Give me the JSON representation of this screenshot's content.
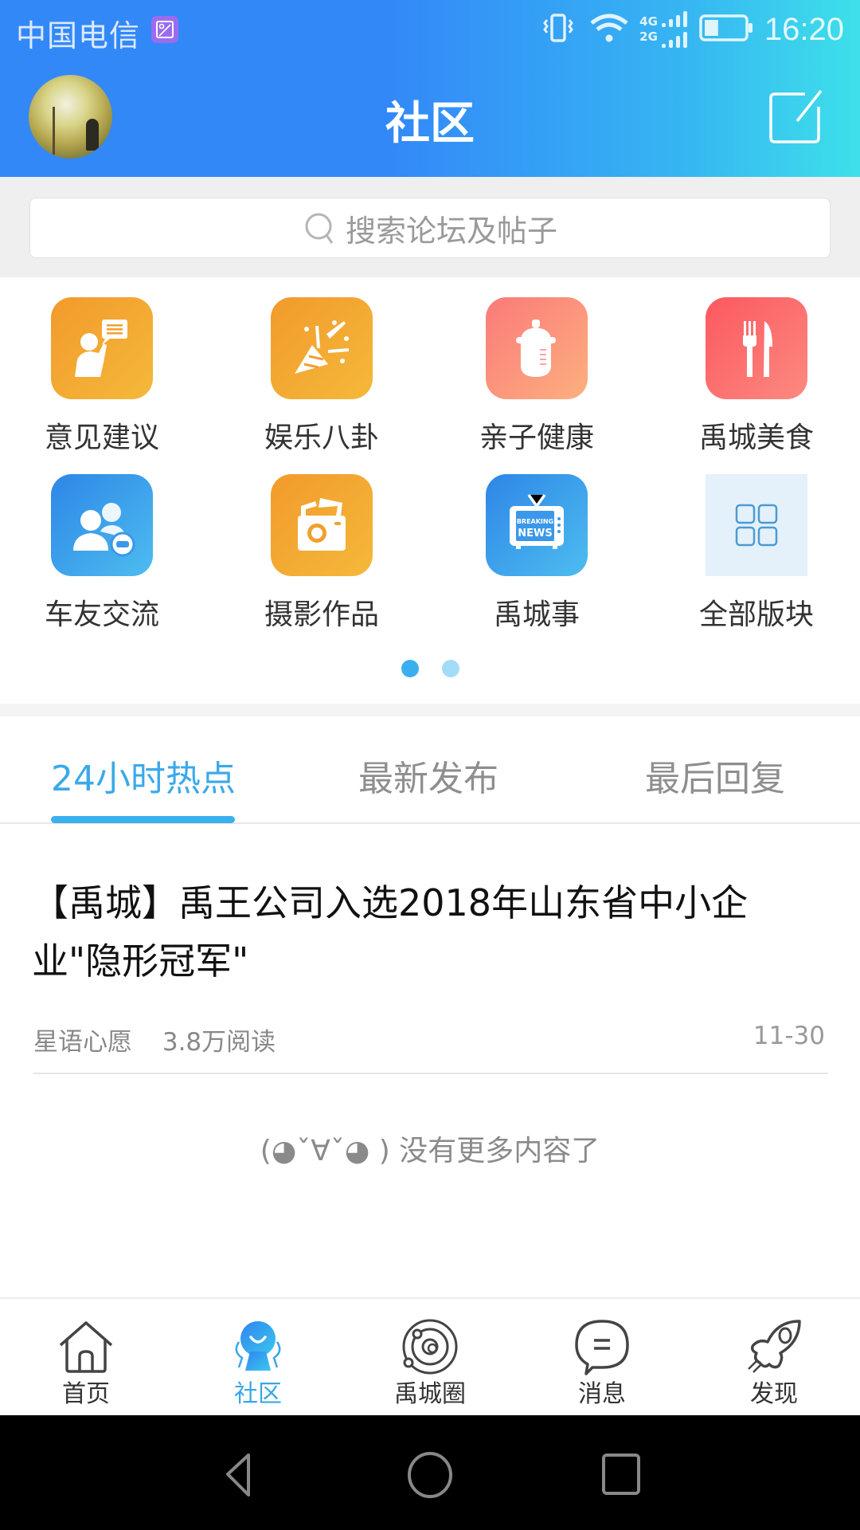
{
  "status_bar": {
    "carrier": "中国电信",
    "network_top": "4G",
    "network_bottom": "2G",
    "battery_level": 0.35,
    "time": "16:20"
  },
  "header": {
    "title": "社区",
    "avatar_alt": "user avatar",
    "compose_icon": "compose-icon"
  },
  "search": {
    "placeholder": "搜索论坛及帖子"
  },
  "categories": [
    {
      "label": "意见建议",
      "icon": "feedback-icon",
      "color_from": "#f29a2c",
      "color_to": "#f4b93a"
    },
    {
      "label": "娱乐八卦",
      "icon": "party-popper-icon",
      "color_from": "#f29a2c",
      "color_to": "#f4b93a"
    },
    {
      "label": "亲子健康",
      "icon": "baby-bottle-icon",
      "color_from": "#fb7a7a",
      "color_to": "#fcb07e"
    },
    {
      "label": "禹城美食",
      "icon": "fork-knife-icon",
      "color_from": "#fc5860",
      "color_to": "#fc8a80"
    },
    {
      "label": "车友交流",
      "icon": "car-friends-icon",
      "color_from": "#2e86e6",
      "color_to": "#4dbdf0"
    },
    {
      "label": "摄影作品",
      "icon": "camera-icon",
      "color_from": "#f29a2c",
      "color_to": "#f4b93a"
    },
    {
      "label": "禹城事",
      "icon": "breaking-news-tv-icon",
      "color_from": "#2e86e6",
      "color_to": "#4dbdf0"
    },
    {
      "label": "全部版块",
      "icon": "grid-icon",
      "color_from": "#e4f1fa",
      "color_to": "#e4f1fa"
    }
  ],
  "pager": {
    "pages": 2,
    "current": 1,
    "active_color": "#3aaeee",
    "inactive_color": "#a3dcf7"
  },
  "tabs": [
    {
      "label": "24小时热点",
      "active": true
    },
    {
      "label": "最新发布",
      "active": false
    },
    {
      "label": "最后回复",
      "active": false
    }
  ],
  "posts": [
    {
      "title": "【禹城】禹王公司入选2018年山东省中小企业\"隐形冠军\"",
      "author": "星语心愿",
      "reads": "3.8万阅读",
      "date": "11-30"
    }
  ],
  "end_message": "(◕ˇ∀ˇ◕ ) 没有更多内容了",
  "bottom_nav": [
    {
      "label": "首页",
      "icon": "home-icon",
      "active": false
    },
    {
      "label": "社区",
      "icon": "community-icon",
      "active": true
    },
    {
      "label": "禹城圈",
      "icon": "orbit-icon",
      "active": false
    },
    {
      "label": "消息",
      "icon": "message-bubble-icon",
      "active": false
    },
    {
      "label": "发现",
      "icon": "rocket-icon",
      "active": false
    }
  ],
  "system_nav": [
    "back",
    "home",
    "recents"
  ],
  "colors": {
    "accent": "#3aa9ea",
    "header_start": "#3388f8",
    "header_end": "#3ee0ea"
  }
}
